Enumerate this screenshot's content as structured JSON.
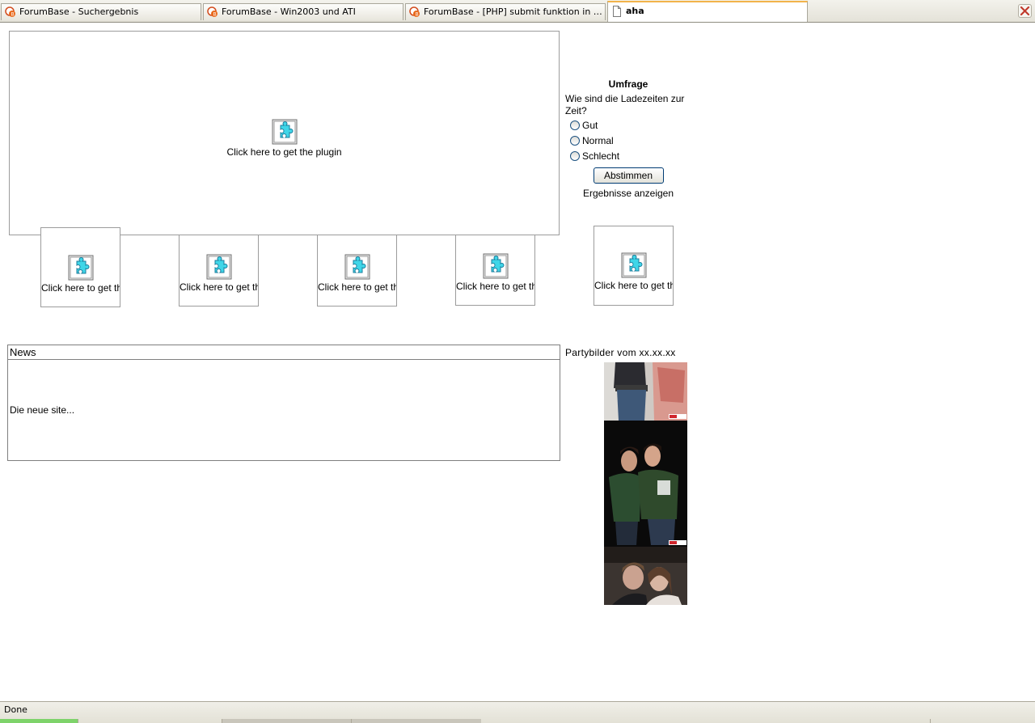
{
  "tabs": [
    {
      "label": "ForumBase - Suchergebnis"
    },
    {
      "label": "ForumBase - Win2003 und ATI"
    },
    {
      "label": "ForumBase - [PHP] submit funktion in php fu..."
    },
    {
      "label": "aha"
    }
  ],
  "plugin_main": {
    "label": "Click here to get the plugin"
  },
  "plugin_small": [
    {
      "label": "Click here to get the"
    },
    {
      "label": "Click here to get the"
    },
    {
      "label": "Click here to get the"
    },
    {
      "label": "Click here to get the"
    },
    {
      "label": "Click here to get the"
    }
  ],
  "poll": {
    "title": "Umfrage",
    "question": "Wie sind die Ladezeiten zur Zeit?",
    "options": [
      "Gut",
      "Normal",
      "Schlecht"
    ],
    "vote_label": "Abstimmen",
    "results_label": "Ergebnisse anzeigen"
  },
  "news": {
    "header": "News",
    "body": "Die neue site..."
  },
  "party": {
    "title": "Partybilder vom xx.xx.xx"
  },
  "status": {
    "text": "Done"
  },
  "colors": {
    "active_tab_accent": "#f2b34b",
    "close_icon": "#c0392b",
    "plugin_icon": "#3fd6e8"
  }
}
